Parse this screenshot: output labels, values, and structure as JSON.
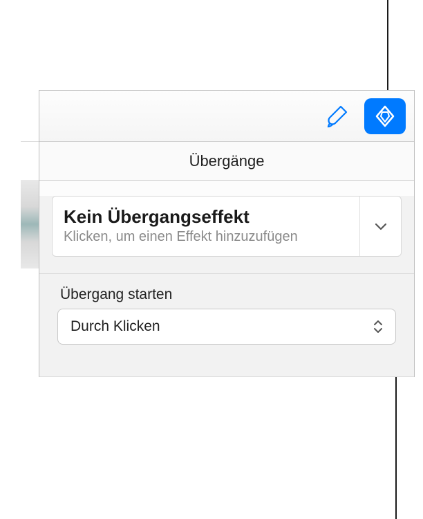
{
  "toolbar": {
    "format_icon": "format-brush-icon",
    "animate_icon": "animate-diamond-icon"
  },
  "tabs": {
    "transitions_label": "Übergänge"
  },
  "effect": {
    "title": "Kein Übergangseffekt",
    "subtitle": "Klicken, um einen Effekt hinzuzufügen"
  },
  "start": {
    "label": "Übergang starten",
    "selected": "Durch Klicken"
  }
}
